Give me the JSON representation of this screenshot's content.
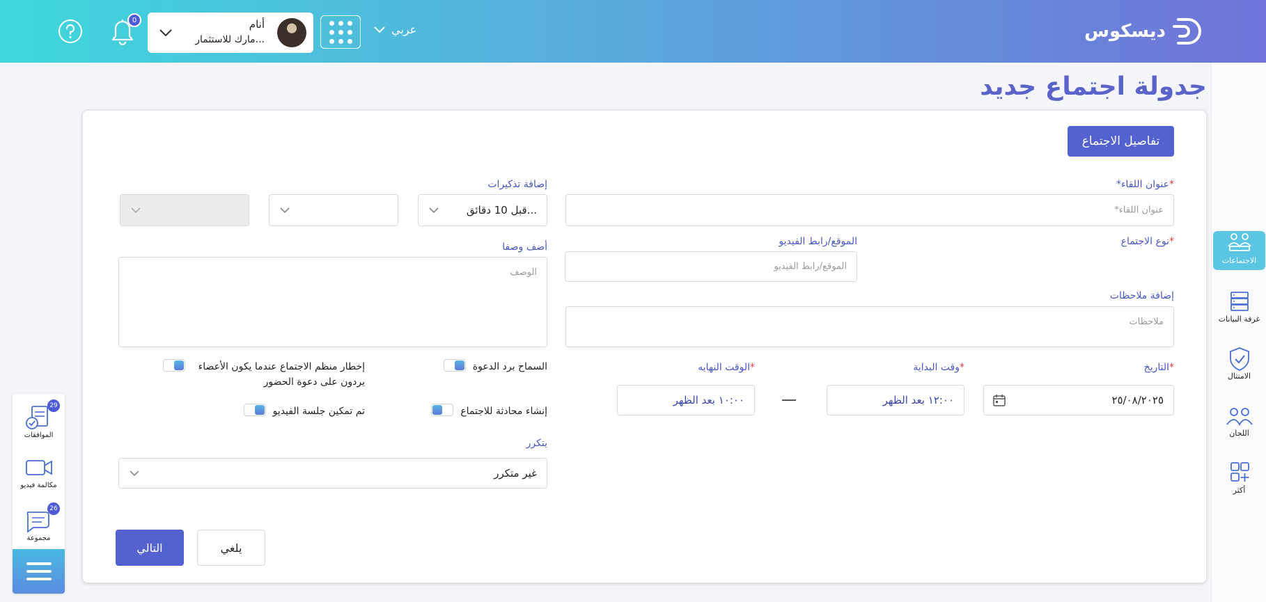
{
  "header": {
    "logo_text": "ديسكوس",
    "language": "عربي",
    "notification_count": "0",
    "user": {
      "name": "أنام",
      "company": "مارك للاستثمار..."
    }
  },
  "page": {
    "title": "جدولة اجتماع جديد"
  },
  "right_sidebar": {
    "items": [
      {
        "label": "الاجتماعات",
        "icon": "meetings-icon"
      },
      {
        "label": "غرفة البيانات",
        "icon": "data-room-icon"
      },
      {
        "label": "الامتثال",
        "icon": "compliance-shield-icon"
      },
      {
        "label": "اللجان",
        "icon": "committees-icon"
      },
      {
        "label": "أكثر",
        "icon": "more-apps-icon"
      }
    ]
  },
  "left_bar": {
    "items": [
      {
        "label": "الموافقات",
        "badge": "29",
        "icon": "approvals-icon"
      },
      {
        "label": "مكالمة فيديو",
        "badge": "",
        "icon": "video-call-icon"
      },
      {
        "label": "مجموعة",
        "badge": "26",
        "icon": "group-chat-icon"
      }
    ]
  },
  "form": {
    "section_button": "تفاصيل الاجتماع",
    "title": {
      "label": "عنوان اللقاء",
      "placeholder": "*عنوان اللقاء"
    },
    "reminders": {
      "label": "إضافة تذكيرات",
      "value": "قبل 10 دقائق..."
    },
    "meeting_type": {
      "label": "نوع الاجتماع"
    },
    "location": {
      "label": "الموقع/رابط الفيديو",
      "placeholder": "الموقع/رابط الفيديو"
    },
    "description": {
      "label": "أضف وصفا",
      "placeholder": "الوصف"
    },
    "notes": {
      "label": "إضافة ملاحظات",
      "placeholder": "ملاحظات"
    },
    "date": {
      "label": "التاريخ",
      "value": "٢٥/٠٨/٢٠٢٥"
    },
    "start_time": {
      "label": "وقت البداية",
      "value": "١٢:٠٠ بعد الظهر"
    },
    "end_time": {
      "label": "الوقت النهايه",
      "value": "١٠:٠٠ بعد الظهر"
    },
    "toggles": {
      "allow_rsvp": "السماح برد الدعوة",
      "notify_organizer": "إخطار منظم الاجتماع عندما يكون الأعضاء يردون على دعوة الحضور",
      "create_chat": "إنشاء محادثة للاجتماع",
      "video_enabled": "تم تمكين جلسة الفيديو"
    },
    "recurrence": {
      "label": "يتكرر",
      "value": "غير متكرر"
    },
    "next_button": "التالي",
    "cancel_button": "يلغي"
  },
  "colors": {
    "accent": "#5462d0",
    "label": "#4a56c6",
    "required": "#e53946"
  }
}
